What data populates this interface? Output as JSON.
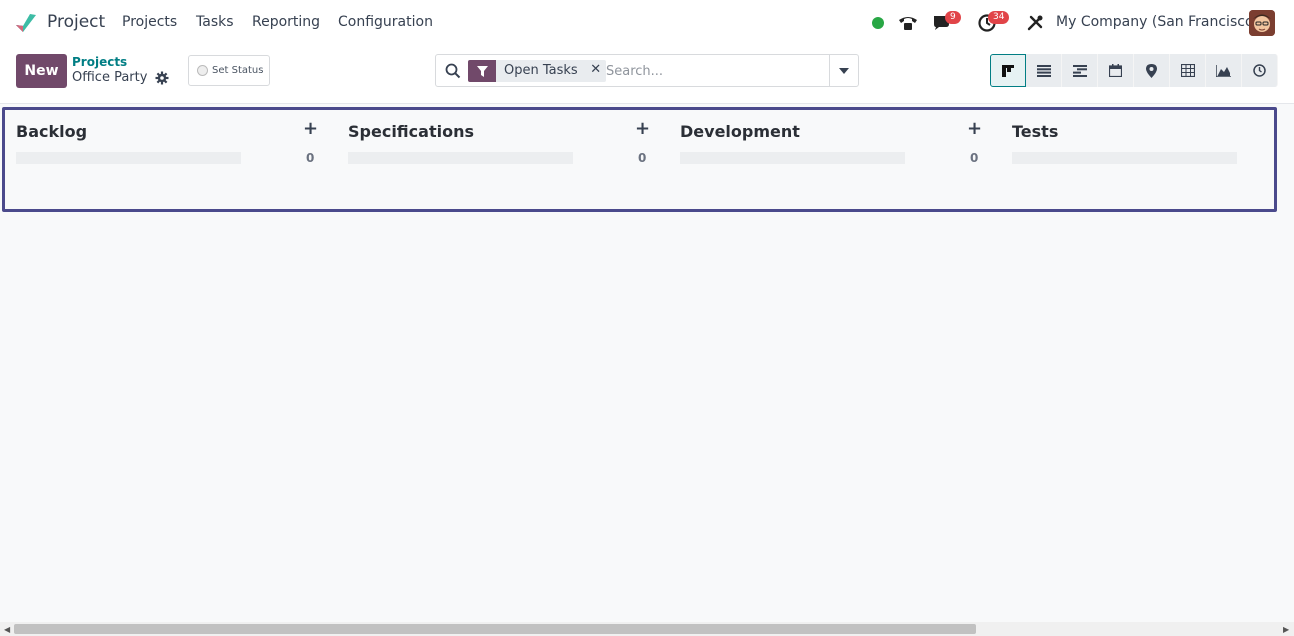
{
  "navbar": {
    "app_name": "Project",
    "menu": [
      "Projects",
      "Tasks",
      "Reporting",
      "Configuration"
    ],
    "messages_badge": "9",
    "activities_badge": "34",
    "company": "My Company (San Francisco)",
    "icons": [
      "status-online-icon",
      "phone-icon",
      "chat-icon",
      "clock-icon",
      "tools-icon"
    ]
  },
  "control": {
    "new_label": "New",
    "breadcrumb_link": "Projects",
    "breadcrumb_current": "Office Party",
    "set_status_label": "Set Status",
    "search": {
      "facet_label": "Open Tasks",
      "placeholder": "Search..."
    },
    "views": [
      "kanban",
      "list",
      "gantt",
      "calendar",
      "map",
      "pivot",
      "graph",
      "activity"
    ],
    "active_view": "kanban"
  },
  "kanban": {
    "columns": [
      {
        "title": "Backlog",
        "count": "0"
      },
      {
        "title": "Specifications",
        "count": "0"
      },
      {
        "title": "Development",
        "count": "0"
      },
      {
        "title": "Tests",
        "count": ""
      }
    ]
  },
  "colors": {
    "primary": "#71496a",
    "accent": "#017e84",
    "badge": "#e14448",
    "online": "#28a745",
    "kanban_border": "#4b4a8c"
  }
}
